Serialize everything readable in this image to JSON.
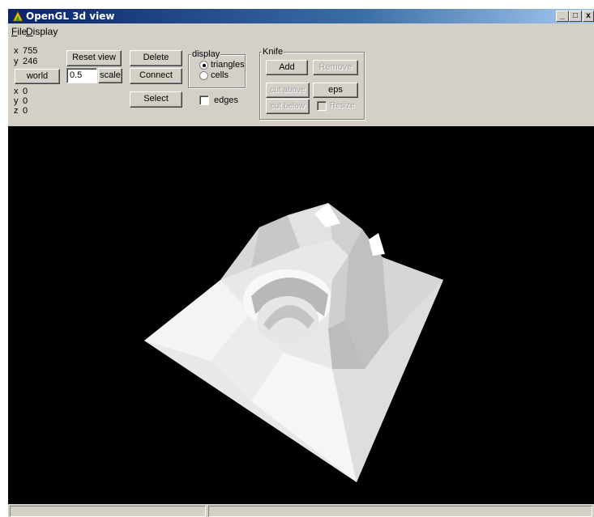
{
  "window": {
    "title": "OpenGL 3d view"
  },
  "caption_buttons": {
    "minimize": "_",
    "maximize": "□",
    "close": "x"
  },
  "menu": [
    {
      "label_first": "F",
      "label_rest": "ile"
    },
    {
      "label_first": "D",
      "label_rest": "isplay"
    }
  ],
  "coords_top": {
    "x_label": "x",
    "x_value": "755",
    "y_label": "y",
    "y_value": "246"
  },
  "world_button": "world",
  "reset_view_button": "Reset view",
  "scale": {
    "value": "0.5",
    "label": "scale"
  },
  "coords_bottom": {
    "x_label": "x",
    "x_value": "0",
    "y_label": "y",
    "y_value": "0",
    "z_label": "z",
    "z_value": "0"
  },
  "buttons": {
    "delete": "Delete",
    "connect": "Connect",
    "select": "Select"
  },
  "display_group": {
    "title": "display",
    "options": [
      "triangles",
      "cells"
    ],
    "selected": "triangles",
    "edges_label": "edges",
    "edges_checked": false
  },
  "knife_group": {
    "title": "Knife",
    "add": "Add",
    "remove": "Remove",
    "cut_above": "cut above",
    "eps": "eps",
    "cut_below": "cut below",
    "resize": "Resize"
  },
  "viewport": {
    "content": "3d-terrain-mesh"
  }
}
